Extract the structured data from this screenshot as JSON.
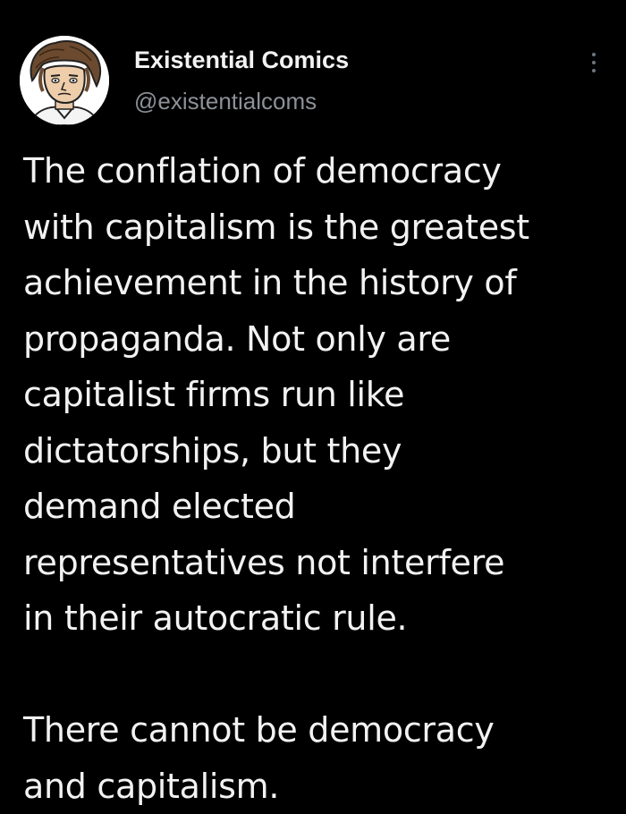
{
  "tweet": {
    "author": {
      "display_name": "Existential Comics",
      "handle": "@existentialcoms",
      "avatar_icon": "cartoon-portrait-avatar"
    },
    "more_icon": "more-vertical-icon",
    "text_lines": [
      "The conflation of democracy",
      "with capitalism is the greatest",
      "achievement in the history of",
      "propaganda. Not only are",
      "capitalist firms run like",
      "dictatorships, but they",
      "demand elected",
      "representatives not interfere",
      "in their autocratic rule."
    ],
    "text_lines_2": [
      "There cannot be democracy",
      "and capitalism."
    ]
  },
  "colors": {
    "background": "#000000",
    "text": "#f2f2f2",
    "secondary_text": "#8b9197"
  }
}
